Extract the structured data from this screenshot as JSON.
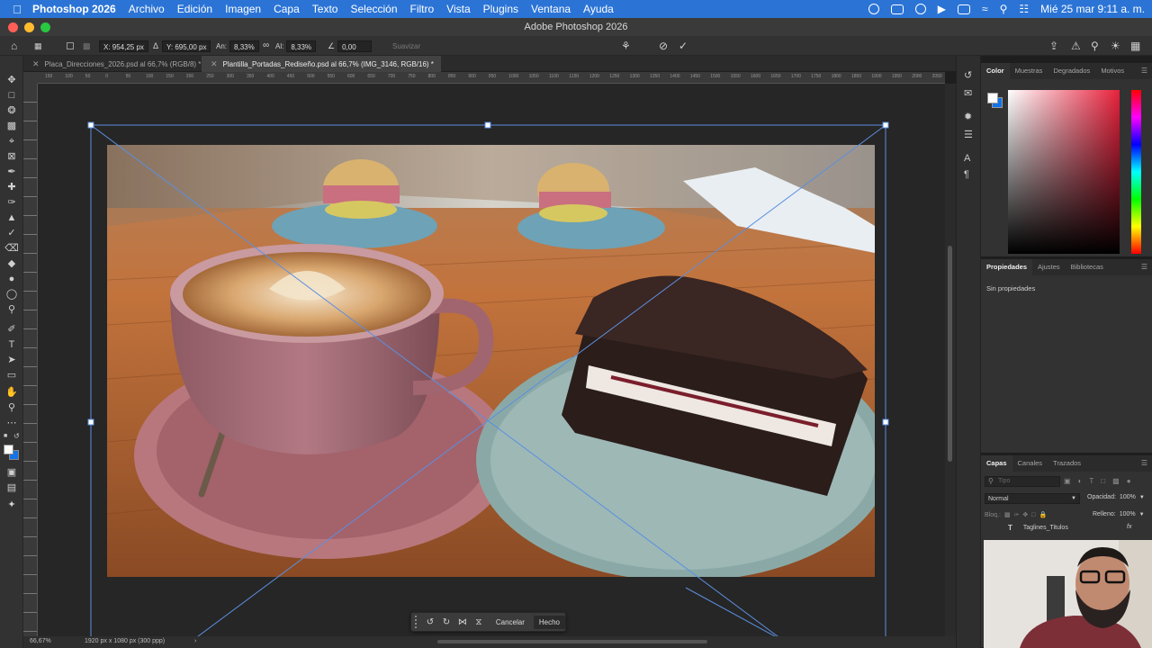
{
  "menubar": {
    "app": "Photoshop 2026",
    "items": [
      "Archivo",
      "Edición",
      "Imagen",
      "Capa",
      "Texto",
      "Selección",
      "Filtro",
      "Vista",
      "Plugins",
      "Ventana",
      "Ayuda"
    ],
    "clock": "Mié 25 mar 9:11 a. m."
  },
  "window": {
    "title": "Adobe Photoshop 2026"
  },
  "options": {
    "x": "X: 954,25 px",
    "y": "Y: 695,00 px",
    "w_label": "An:",
    "w": "8,33%",
    "h_label": "Al:",
    "h": "8,33%",
    "angle": "0,00",
    "smooth": "Suavizar"
  },
  "tabs": [
    {
      "label": "Placa_Direcciones_2026.psd al 66,7% (RGB/8) *"
    },
    {
      "label": "Plantilla_Portadas_Rediseño.psd al 66,7% (IMG_3146, RGB/16) *"
    }
  ],
  "ruler": {
    "ticks": [
      "150",
      "100",
      "50",
      "0",
      "50",
      "100",
      "150",
      "200",
      "250",
      "300",
      "350",
      "400",
      "450",
      "500",
      "550",
      "600",
      "650",
      "700",
      "750",
      "800",
      "850",
      "900",
      "950",
      "1000",
      "1050",
      "1100",
      "1150",
      "1200",
      "1250",
      "1300",
      "1350",
      "1400",
      "1450",
      "1500",
      "1550",
      "1600",
      "1650",
      "1700",
      "1750",
      "1800",
      "1850",
      "1900",
      "1950",
      "2000",
      "2050"
    ]
  },
  "ctxbar": {
    "cancel": "Cancelar",
    "done": "Hecho"
  },
  "status": {
    "zoom": "66,67%",
    "doc": "1920 px x 1080 px (300 ppp)"
  },
  "color_panel": {
    "tabs": [
      "Color",
      "Muestras",
      "Degradados",
      "Motivos"
    ],
    "active_hue": "#e8213c"
  },
  "props_panel": {
    "tabs": [
      "Propiedades",
      "Ajustes",
      "Bibliotecas"
    ],
    "empty": "Sin propiedades"
  },
  "layers_panel": {
    "tabs": [
      "Capas",
      "Canales",
      "Trazados"
    ],
    "search": "Tipo",
    "blend": "Normal",
    "opacity_label": "Opacidad:",
    "opacity": "100%",
    "lock_label": "Bloq.:",
    "fill_label": "Relleno:",
    "fill": "100%",
    "layer": "Taglines_Titulos",
    "fx": "fx"
  }
}
